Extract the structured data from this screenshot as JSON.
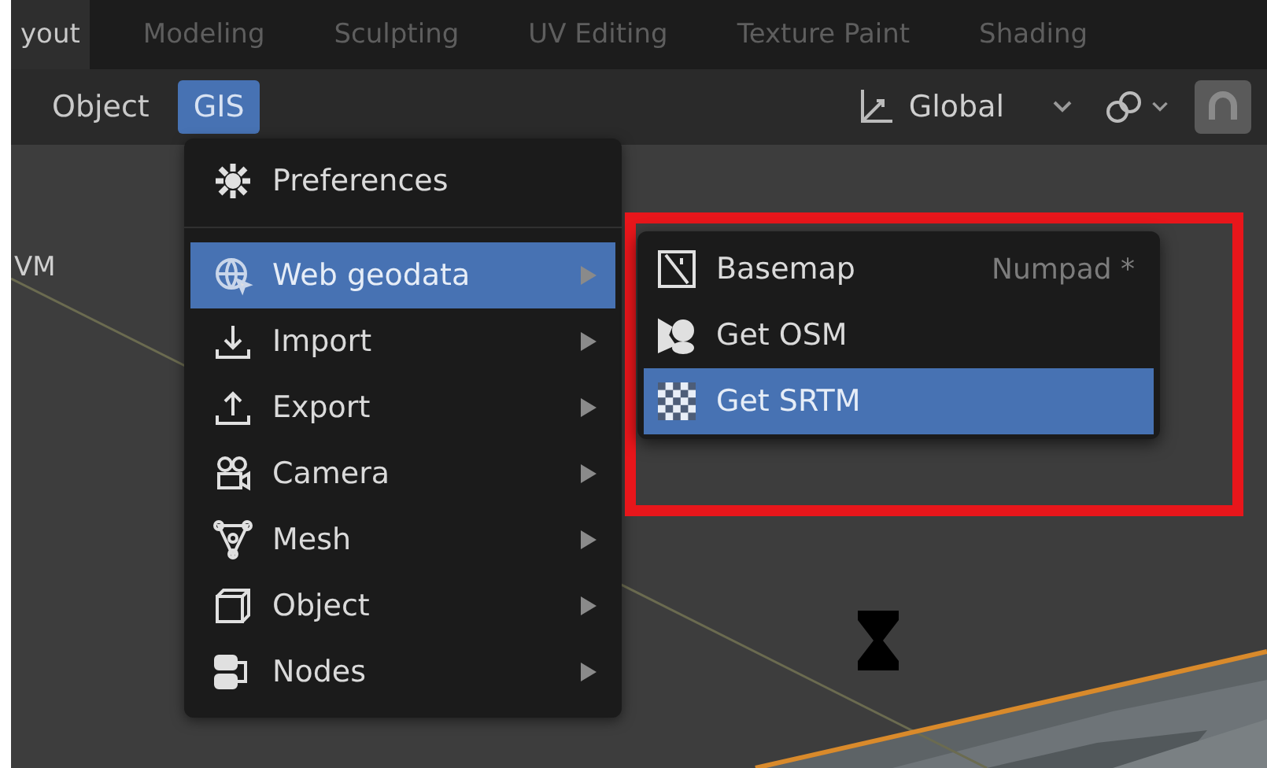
{
  "workspace_tabs": [
    {
      "label": "yout",
      "selected": true
    },
    {
      "label": "Modeling",
      "selected": false
    },
    {
      "label": "Sculpting",
      "selected": false
    },
    {
      "label": "UV Editing",
      "selected": false
    },
    {
      "label": "Texture Paint",
      "selected": false
    },
    {
      "label": "Shading",
      "selected": false
    }
  ],
  "header": {
    "menus": [
      {
        "label": "Object",
        "selected": false
      },
      {
        "label": "GIS",
        "selected": true
      }
    ],
    "orientation": "Global"
  },
  "viewport": {
    "overlay_text": "VM"
  },
  "gis_menu": [
    {
      "kind": "item",
      "label": "Preferences",
      "submenu": false,
      "selected": false
    },
    {
      "kind": "separator"
    },
    {
      "kind": "item",
      "label": "Web geodata",
      "submenu": true,
      "selected": true
    },
    {
      "kind": "item",
      "label": "Import",
      "submenu": true,
      "selected": false
    },
    {
      "kind": "item",
      "label": "Export",
      "submenu": true,
      "selected": false
    },
    {
      "kind": "item",
      "label": "Camera",
      "submenu": true,
      "selected": false
    },
    {
      "kind": "item",
      "label": "Mesh",
      "submenu": true,
      "selected": false
    },
    {
      "kind": "item",
      "label": "Object",
      "submenu": true,
      "selected": false
    },
    {
      "kind": "item",
      "label": "Nodes",
      "submenu": true,
      "selected": false
    }
  ],
  "web_geodata_menu": [
    {
      "label": "Basemap",
      "shortcut": "Numpad *",
      "selected": false
    },
    {
      "label": "Get OSM",
      "selected": false
    },
    {
      "label": "Get SRTM",
      "selected": true
    }
  ]
}
